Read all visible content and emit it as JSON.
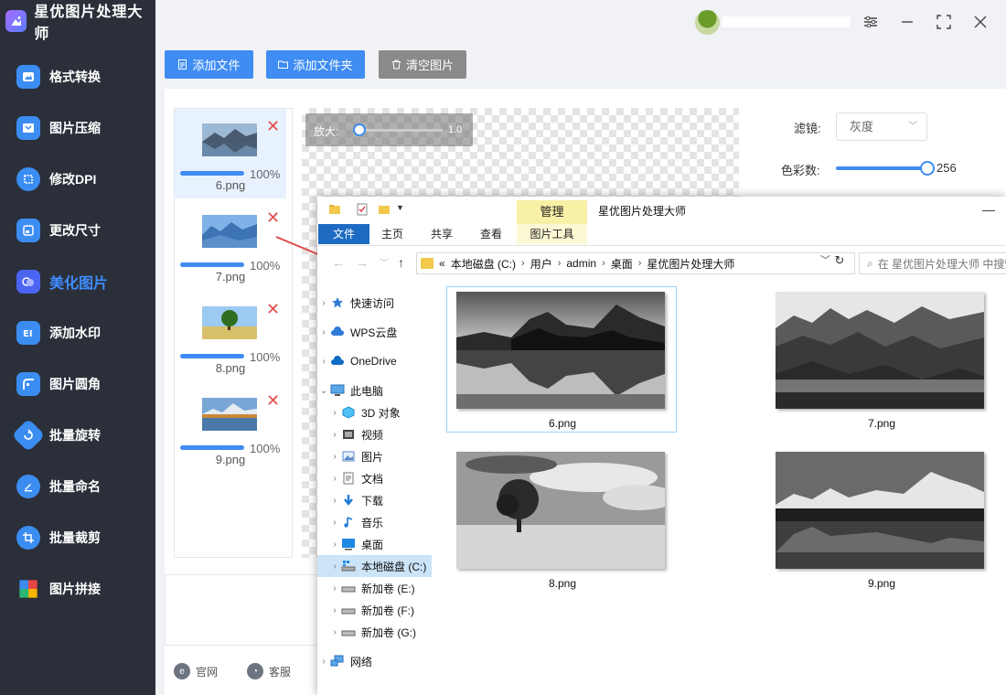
{
  "app": {
    "title": "星优图片处理大师"
  },
  "sidebar": {
    "items": [
      {
        "label": "格式转换"
      },
      {
        "label": "图片压缩"
      },
      {
        "label": "修改DPI"
      },
      {
        "label": "更改尺寸"
      },
      {
        "label": "美化图片",
        "active": true
      },
      {
        "label": "添加水印"
      },
      {
        "label": "图片圆角"
      },
      {
        "label": "批量旋转"
      },
      {
        "label": "批量命名"
      },
      {
        "label": "批量裁剪"
      },
      {
        "label": "图片拼接"
      }
    ]
  },
  "toolbar": {
    "add_file": "添加文件",
    "add_folder": "添加文件夹",
    "clear": "清空图片"
  },
  "files": [
    {
      "name": "6.png",
      "progress": "100%"
    },
    {
      "name": "7.png",
      "progress": "100%"
    },
    {
      "name": "8.png",
      "progress": "100%"
    },
    {
      "name": "9.png",
      "progress": "100%"
    }
  ],
  "zoom": {
    "label": "放大:",
    "value": "1.0"
  },
  "settings": {
    "filter_label": "滤镜:",
    "filter_value": "灰度",
    "color_label": "色彩数:",
    "color_value": "256"
  },
  "footer": {
    "website": "官网",
    "service": "客服"
  },
  "explorer": {
    "title": "星优图片处理大师",
    "context_tab": "管理",
    "context_subtab": "图片工具",
    "tabs": [
      "文件",
      "主页",
      "共享",
      "查看"
    ],
    "breadcrumb": [
      "本地磁盘 (C:)",
      "用户",
      "admin",
      "桌面",
      "星优图片处理大师"
    ],
    "breadcrumb_prefix": "«",
    "search_placeholder": "在 星优图片处理大师 中搜索",
    "nav": [
      {
        "label": "快速访问"
      },
      {
        "label": "WPS云盘"
      },
      {
        "label": "OneDrive"
      },
      {
        "label": "此电脑"
      },
      {
        "label": "3D 对象"
      },
      {
        "label": "视频"
      },
      {
        "label": "图片"
      },
      {
        "label": "文档"
      },
      {
        "label": "下载"
      },
      {
        "label": "音乐"
      },
      {
        "label": "桌面"
      },
      {
        "label": "本地磁盘 (C:)"
      },
      {
        "label": "新加卷 (E:)"
      },
      {
        "label": "新加卷 (F:)"
      },
      {
        "label": "新加卷 (G:)"
      },
      {
        "label": "网络"
      }
    ],
    "files": [
      {
        "name": "6.png"
      },
      {
        "name": "7.png"
      },
      {
        "name": "8.png"
      },
      {
        "name": "9.png"
      }
    ]
  }
}
